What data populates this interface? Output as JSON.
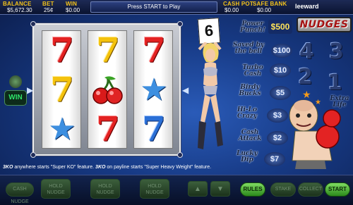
{
  "topbar": {
    "balance_label": "BALANCE",
    "balance_value": "$5,672.30",
    "bet_label": "BET",
    "bet_value": "25¢",
    "win_label": "WIN",
    "win_value": "$0.00",
    "message": "Press START to Play",
    "cashpot_label": "CASH POT",
    "cashpot_value": "$0.00",
    "safebank_label": "SAFE BANK",
    "safebank_value": "$0.00",
    "username": "leeward"
  },
  "reels": [
    [
      "seven-red",
      "seven-gold",
      "star"
    ],
    [
      "seven-gold",
      "cherries",
      "seven-red"
    ],
    [
      "seven-red",
      "star",
      "seven-blue"
    ]
  ],
  "win_badge": "WIN",
  "card_number": "6",
  "logo_text": "NUDGES",
  "features": [
    "Power Punch!",
    "Saved by the bell",
    "Turbo Cash",
    "Birdy Bucks",
    "Hi-Lo Crazy",
    "Cash Attack",
    "Lucky Dip"
  ],
  "prizes": [
    "$500",
    "$100",
    "$10",
    "$5",
    "$3",
    "$2",
    "$7"
  ],
  "big_numbers": [
    "4",
    "3",
    "2",
    "1"
  ],
  "extra_life": "Extra Life",
  "info": {
    "count1": "3",
    "ko1": "KO",
    "text1": " anywhere starts \"Super KO\" feature. ",
    "count2": "3",
    "ko2": "KO",
    "text2": " on payline starts \"Super Heavy Weight\" feature."
  },
  "buttons": {
    "pill1": "CASH NUDGE",
    "hold1": "HOLD NUDGE",
    "hold2": "HOLD NUDGE",
    "hold3": "HOLD NUDGE",
    "rules": "RULES",
    "pill2": "STAKE",
    "pill3": "COLLECT",
    "start": "START"
  },
  "colors": {
    "accent_gold": "#f3c21b",
    "start_green": "#4cbf35",
    "background_blue": "#173a85"
  }
}
